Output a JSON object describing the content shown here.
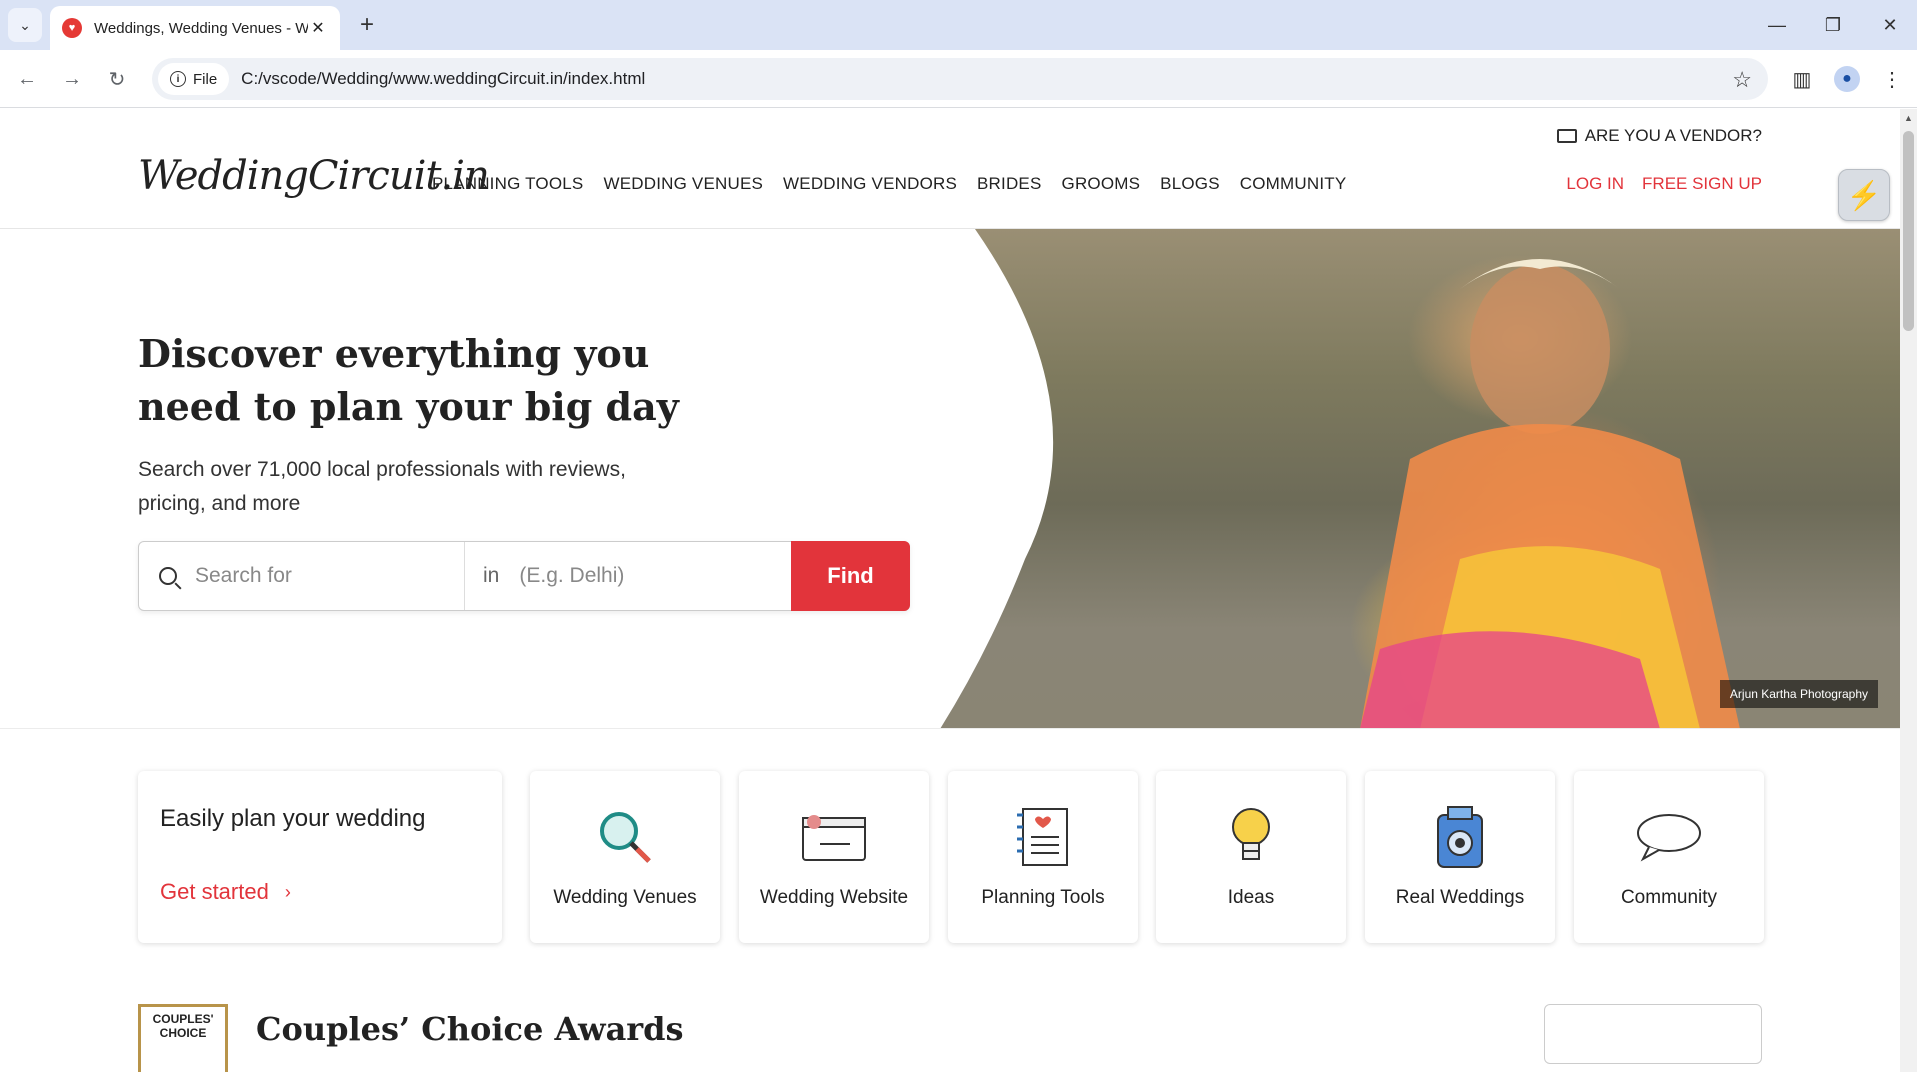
{
  "browser": {
    "tab_title": "Weddings, Wedding Venues - W",
    "address_chip": "File",
    "url": "C:/vscode/Wedding/www.weddingCircuit.in/index.html"
  },
  "header": {
    "logo": "WeddingCircuit.in",
    "nav": [
      "PLANNING TOOLS",
      "WEDDING VENUES",
      "WEDDING VENDORS",
      "BRIDES",
      "GROOMS",
      "BLOGS",
      "COMMUNITY"
    ],
    "vendor_link": "ARE YOU A VENDOR?",
    "login": "LOG IN",
    "signup": "FREE SIGN UP"
  },
  "hero": {
    "title": "Discover everything you need to plan your big day",
    "subtitle": "Search over 71,000 local professionals with reviews, pricing, and more",
    "search_placeholder": "Search for",
    "location_prefix": "in",
    "location_placeholder": "(E.g. Delhi)",
    "find_label": "Find",
    "photo_credit": "Arjun Kartha Photography"
  },
  "plan": {
    "title": "Easily plan your wedding",
    "cta": "Get started"
  },
  "tiles": [
    {
      "label": "Wedding Venues",
      "icon": "magnifier-icon"
    },
    {
      "label": "Wedding Website",
      "icon": "website-icon"
    },
    {
      "label": "Planning Tools",
      "icon": "notebook-icon"
    },
    {
      "label": "Ideas",
      "icon": "lightbulb-icon"
    },
    {
      "label": "Real Weddings",
      "icon": "camera-icon"
    },
    {
      "label": "Community",
      "icon": "speech-bubble-icon"
    }
  ],
  "awards": {
    "badge_line1": "COUPLES'",
    "badge_line2": "CHOICE",
    "title": "Couples’ Choice Awards"
  },
  "colors": {
    "accent": "#e2343b",
    "tabbar": "#dae3f5"
  }
}
